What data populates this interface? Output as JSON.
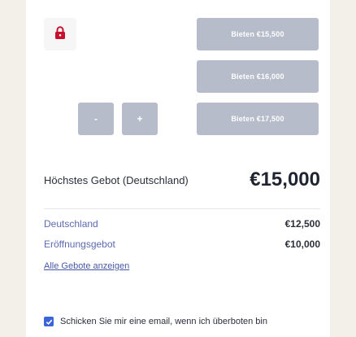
{
  "bid_buttons": [
    {
      "label": "Bieten €15,500"
    },
    {
      "label": "Bieten €16,000"
    },
    {
      "label": "Bieten €17,500"
    }
  ],
  "stepper": {
    "minus": "-",
    "plus": "+"
  },
  "highest_bid": {
    "label": "Höchstes Gebot (Deutschland)",
    "amount": "€15,000"
  },
  "bids": [
    {
      "label": "Deutschland",
      "value": "€12,500"
    },
    {
      "label": "Eröffnungsgebot",
      "value": "€10,000"
    }
  ],
  "all_bids_link": "Alle Gebote anzeigen",
  "notify_checkbox": {
    "label": "Schicken Sie mir eine email, wenn ich überboten bin",
    "checked": true
  },
  "colors": {
    "lock": "#c8102e",
    "button": "#b6bcc9",
    "checkbox": "#3b64d8"
  },
  "icons": {
    "lock": "lock-icon",
    "check": "check-icon"
  }
}
